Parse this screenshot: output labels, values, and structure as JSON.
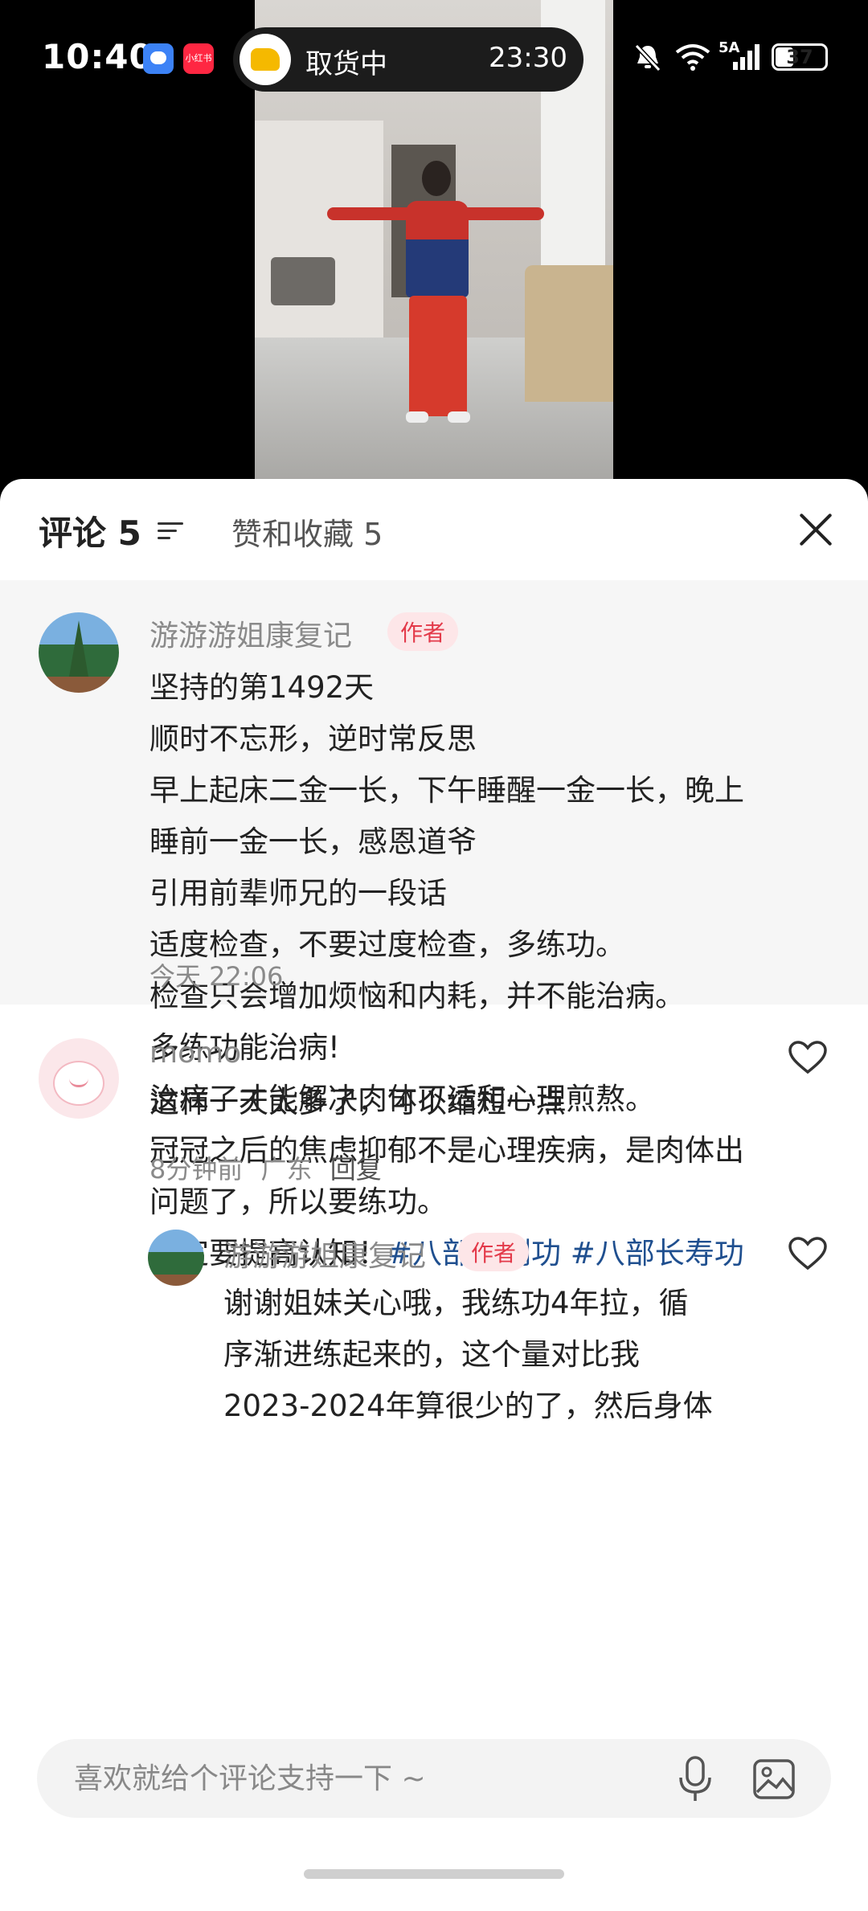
{
  "status_bar": {
    "time": "10:40",
    "xhs_icon_text": "小红书",
    "delivery_status": "取货中",
    "delivery_time": "23:30",
    "network": "5A",
    "battery": "37",
    "battery_level_percent": 37
  },
  "sheet": {
    "tab_comments": "评论 5",
    "tab_likes": "赞和收藏 5"
  },
  "pinned_comment": {
    "user": "游游游姐康复记",
    "badge": "作者",
    "lines": [
      "坚持的第1492天",
      "顺时不忘形，逆时常反思",
      "早上起床二金一长，下午睡醒一金一长，晚上",
      "睡前一金一长，感恩道爷",
      "引用前辈师兄的一段话",
      "适度检查，不要过度检查，多练功。",
      "检查只会增加烦恼和内耗，并不能治病。",
      "多练功能治病!",
      "治病了才能解决肉体不适和心理煎熬。",
      "冠冠之后的焦虑抑郁不是心理疾病，是肉体出",
      "问题了，所以要练功。"
    ],
    "last_line_prefix": "一定要提高认知！",
    "hashtags": [
      "#八部金刚功",
      "#八部长寿功"
    ],
    "time": "今天 22:06"
  },
  "comment_momo": {
    "user": "momo",
    "text": "这样一天太多了，可以缩短一点",
    "time": "8分钟前",
    "location": "广东",
    "reply_label": "回复"
  },
  "author_reply": {
    "user": "游游游姐康复记",
    "badge": "作者",
    "lines": [
      "谢谢姐妹关心哦，我练功4年拉，循",
      "序渐进练起来的，这个量对比我",
      "2023-2024年算很少的了，然后身体"
    ]
  },
  "input": {
    "placeholder": "喜欢就给个评论支持一下 ~"
  }
}
